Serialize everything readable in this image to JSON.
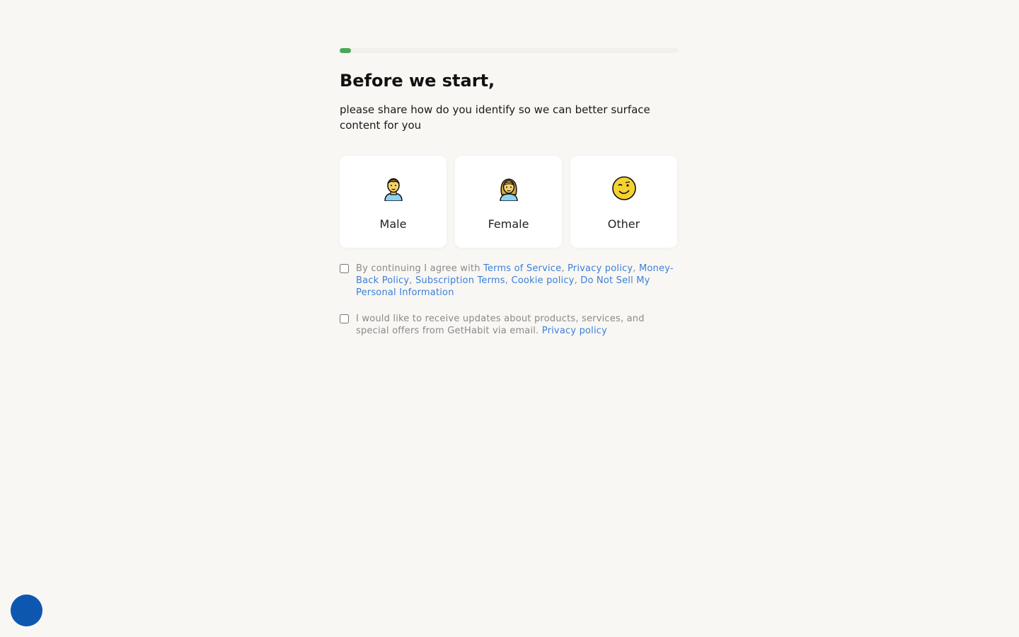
{
  "progress": {
    "fraction": 0.033,
    "color": "#4aa85a"
  },
  "heading": "Before we start,",
  "subtitle": "please share how do you identify so we can better surface content for you",
  "options": [
    {
      "label": "Male",
      "icon": "man-icon"
    },
    {
      "label": "Female",
      "icon": "woman-icon"
    },
    {
      "label": "Other",
      "icon": "winking-face-icon"
    }
  ],
  "consent_terms": {
    "prefix": "By continuing I agree with ",
    "links": [
      "Terms of Service",
      "Privacy policy",
      "Money-Back Policy",
      "Subscription Terms",
      "Cookie policy",
      "Do Not Sell My Personal Information"
    ],
    "separator": ", "
  },
  "consent_updates": {
    "text": "I would like to receive updates about products, services, and special offers from GetHabit via email. ",
    "link": "Privacy policy"
  },
  "colors": {
    "background": "#f8f7f4",
    "link": "#3d7fd6",
    "help_bubble": "#0e57b1"
  }
}
